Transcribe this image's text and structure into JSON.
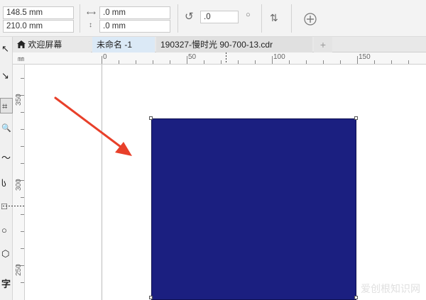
{
  "property_bar": {
    "position_x": "148.5 mm",
    "position_y": "210.0 mm",
    "size_w": ".0 mm",
    "size_h": ".0 mm",
    "rotation": ".0"
  },
  "tabs": [
    {
      "label": "欢迎屏幕",
      "icon": "home-icon",
      "active": false
    },
    {
      "label": "未命名 -1",
      "active": true
    },
    {
      "label": "190327-慢时光 90-700-13.cdr",
      "active": false
    },
    {
      "label": "+",
      "icon": "add-tab-icon"
    }
  ],
  "ruler": {
    "horizontal_labels": [
      "0",
      "50",
      "100",
      "150"
    ],
    "vertical_labels": [
      "350",
      "300",
      "250"
    ],
    "unit_glyph": "㎜"
  },
  "tools": [
    {
      "name": "pick-tool",
      "glyph": "↖"
    },
    {
      "name": "shape-tool",
      "glyph": "↘"
    },
    {
      "name": "crop-tool",
      "glyph": "⌗"
    },
    {
      "name": "zoom-tool",
      "glyph": "🔍"
    },
    {
      "name": "freehand-tool",
      "glyph": "〜"
    },
    {
      "name": "artistic-media-tool",
      "glyph": "ს"
    },
    {
      "name": "rectangle-tool",
      "glyph": "□"
    },
    {
      "name": "ellipse-tool",
      "glyph": "○"
    },
    {
      "name": "polygon-tool",
      "glyph": "⬡"
    },
    {
      "name": "text-tool",
      "glyph": "字"
    }
  ],
  "canvas": {
    "rectangle_color": "#1b1f80",
    "annotation_arrow_color": "#e8402a"
  },
  "watermark": "爱创根知识网"
}
